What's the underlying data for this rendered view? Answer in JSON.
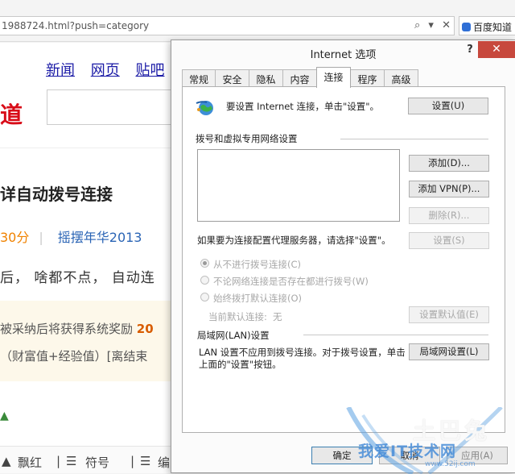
{
  "browser": {
    "url": "1988724.html?push=category",
    "tab_label": "百度知道 -",
    "colors": {
      "tab_icon": "#2f6fd6"
    }
  },
  "page": {
    "nav_links": [
      "新闻",
      "网页",
      "贴吧"
    ],
    "logo_char": "道",
    "question_title": "详自动拨号连接",
    "meta": {
      "score": "30分",
      "user": "摇摆年华2013"
    },
    "body_text": "后， 啥都不点， 自动连",
    "award_line1_prefix": "被采纳后将获得系统奖励",
    "award_line1_num": "20",
    "award_line2": "（财富值+经验值）[离结束",
    "bottom_bar": [
      "飘红",
      "符号",
      "编"
    ],
    "colors": {
      "logo": "#d80c18",
      "score": "#f08200",
      "link": "#1a1aa6"
    }
  },
  "dialog": {
    "title": "Internet 选项",
    "help": "?",
    "close": "✕",
    "tabs": [
      "常规",
      "安全",
      "隐私",
      "内容",
      "连接",
      "程序",
      "高级"
    ],
    "active_tab": "连接",
    "setup_text": "要设置 Internet 连接，单击\"设置\"。",
    "setup_btn": "设置(U)",
    "dial_section": "拨号和虚拟专用网络设置",
    "add_btn": "添加(D)...",
    "add_vpn_btn": "添加 VPN(P)...",
    "remove_btn": "删除(R)...",
    "proxy_text": "如果要为连接配置代理服务器，请选择\"设置\"。",
    "settings_btn": "设置(S)",
    "radio_never": "从不进行拨号连接(C)",
    "radio_when_no_network": "不论网络连接是否存在都进行拨号(W)",
    "radio_always": "始终拨打默认连接(O)",
    "default_conn_label": "当前默认连接:",
    "default_conn_value": "无",
    "set_default_btn": "设置默认值(E)",
    "lan_section": "局域网(LAN)设置",
    "lan_text_line1": "LAN 设置不应用到拨号连接。对于拨号设置，单击",
    "lan_text_line2": "上面的\"设置\"按钮。",
    "lan_btn": "局域网设置(L)",
    "ok": "确定",
    "cancel": "取消",
    "apply": "应用(A)",
    "colors": {
      "close_bg": "#c7483d",
      "primary_border": "#3c7fb1"
    }
  },
  "watermark": {
    "main": "我爱IT技术网",
    "sub": "www.52ij.com",
    "ghost": "土巴兔"
  }
}
